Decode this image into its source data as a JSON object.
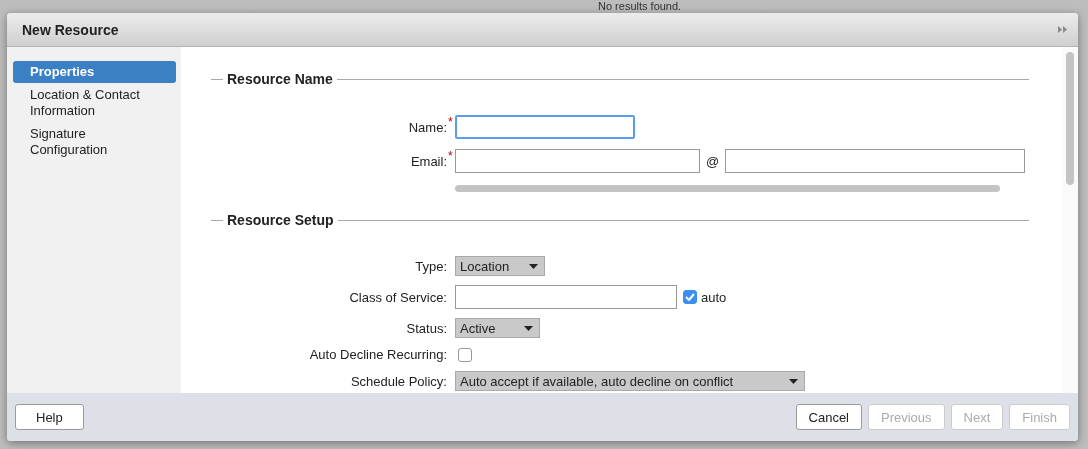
{
  "background": {
    "message": "No results found."
  },
  "window": {
    "title": "New Resource"
  },
  "sidebar": {
    "items": [
      {
        "label": "Properties",
        "selected": true
      },
      {
        "label": "Location & Contact Information",
        "selected": false
      },
      {
        "label": "Signature Configuration",
        "selected": false
      }
    ]
  },
  "sections": [
    {
      "title": "Resource Name",
      "fields": [
        {
          "kind": "text",
          "label": "Name:",
          "required_mark": "*",
          "focused": true
        },
        {
          "kind": "email",
          "label": "Email:",
          "required_mark": "*",
          "separator": "@"
        }
      ]
    },
    {
      "title": "Resource Setup",
      "fields": [
        {
          "kind": "select",
          "label": "Type:",
          "value": "Location"
        },
        {
          "kind": "text_auto",
          "label": "Class of Service:",
          "checkbox_label": "auto",
          "checked": true
        },
        {
          "kind": "select",
          "label": "Status:",
          "value": "Active"
        },
        {
          "kind": "checkbox",
          "label": "Auto Decline Recurring:",
          "checked": false
        },
        {
          "kind": "select",
          "label": "Schedule Policy:",
          "value": "Auto accept if available, auto decline on conflict"
        }
      ]
    }
  ],
  "footer": {
    "left": [
      {
        "label": "Help",
        "disabled": false
      }
    ],
    "right": [
      {
        "label": "Cancel",
        "disabled": false
      },
      {
        "label": "Previous",
        "disabled": true
      },
      {
        "label": "Next",
        "disabled": true
      },
      {
        "label": "Finish",
        "disabled": true
      }
    ]
  }
}
